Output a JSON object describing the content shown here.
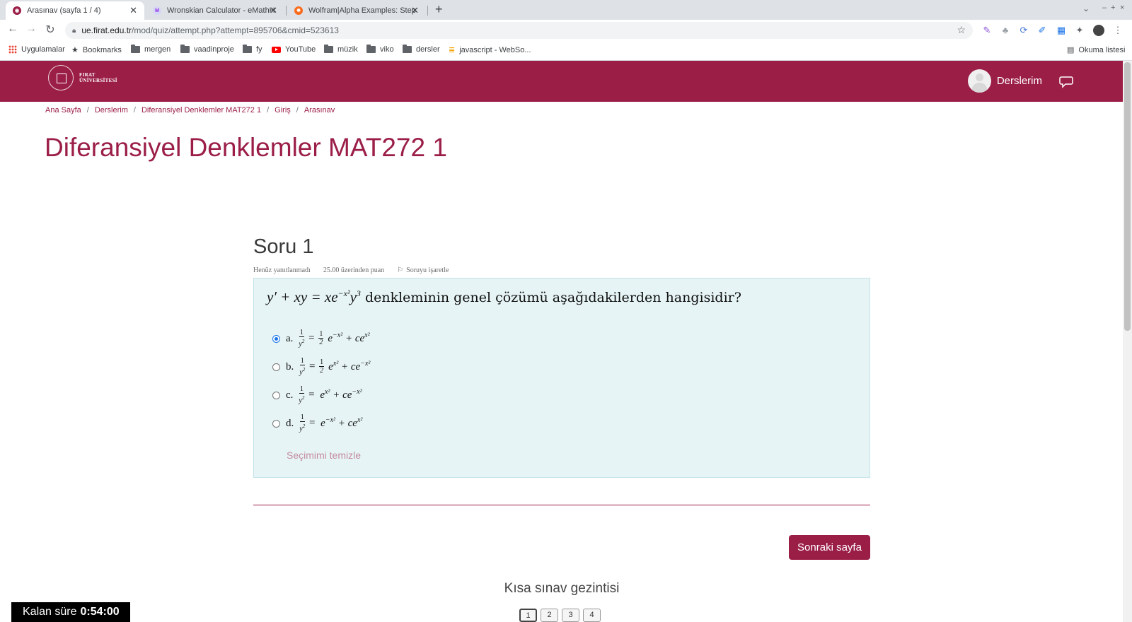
{
  "browser": {
    "tabs": [
      {
        "title": "Arasınav (sayfa 1 / 4)",
        "active": true
      },
      {
        "title": "Wronskian Calculator - eMathHelp",
        "active": false
      },
      {
        "title": "Wolfram|Alpha Examples: Step-by-Step",
        "active": false
      }
    ],
    "url_host": "ue.firat.edu.tr",
    "url_path": "/mod/quiz/attempt.php?attempt=895706&cmid=523613",
    "bookmarks": [
      "Uygulamalar",
      "Bookmarks",
      "mergen",
      "vaadinproje",
      "fy",
      "YouTube",
      "müzik",
      "viko",
      "dersler",
      "javascript - WebSo..."
    ],
    "reading_list": "Okuma listesi"
  },
  "site": {
    "logo_line1": "FIRAT",
    "logo_line2": "ÜNİVERSİTESİ",
    "user_menu_label": "Derslerim",
    "accent_color": "#9b1e47"
  },
  "breadcrumb": [
    "Ana Sayfa",
    "Derslerim",
    "Diferansiyel Denklemler MAT272 1",
    "Giriş",
    "Arasınav"
  ],
  "page_title": "Diferansiyel Denklemler MAT272 1",
  "question": {
    "title": "Soru 1",
    "status": "Henüz yanıtlanmadı",
    "points": "25.00 üzerinden puan",
    "flag_label": "Soruyu işaretle",
    "text_suffix": "denkleminin genel çözümü aşağıdakilerden hangisidir?",
    "answers": [
      {
        "letter": "a.",
        "checked": true
      },
      {
        "letter": "b.",
        "checked": false
      },
      {
        "letter": "c.",
        "checked": false
      },
      {
        "letter": "d.",
        "checked": false
      }
    ],
    "clear_label": "Seçimimi temizle"
  },
  "next_button": "Sonraki sayfa",
  "quiz_nav": {
    "title": "Kısa sınav gezintisi",
    "pages": [
      "1",
      "2",
      "3",
      "4"
    ]
  },
  "timer": {
    "label": "Kalan süre",
    "value": "0:54:00"
  }
}
